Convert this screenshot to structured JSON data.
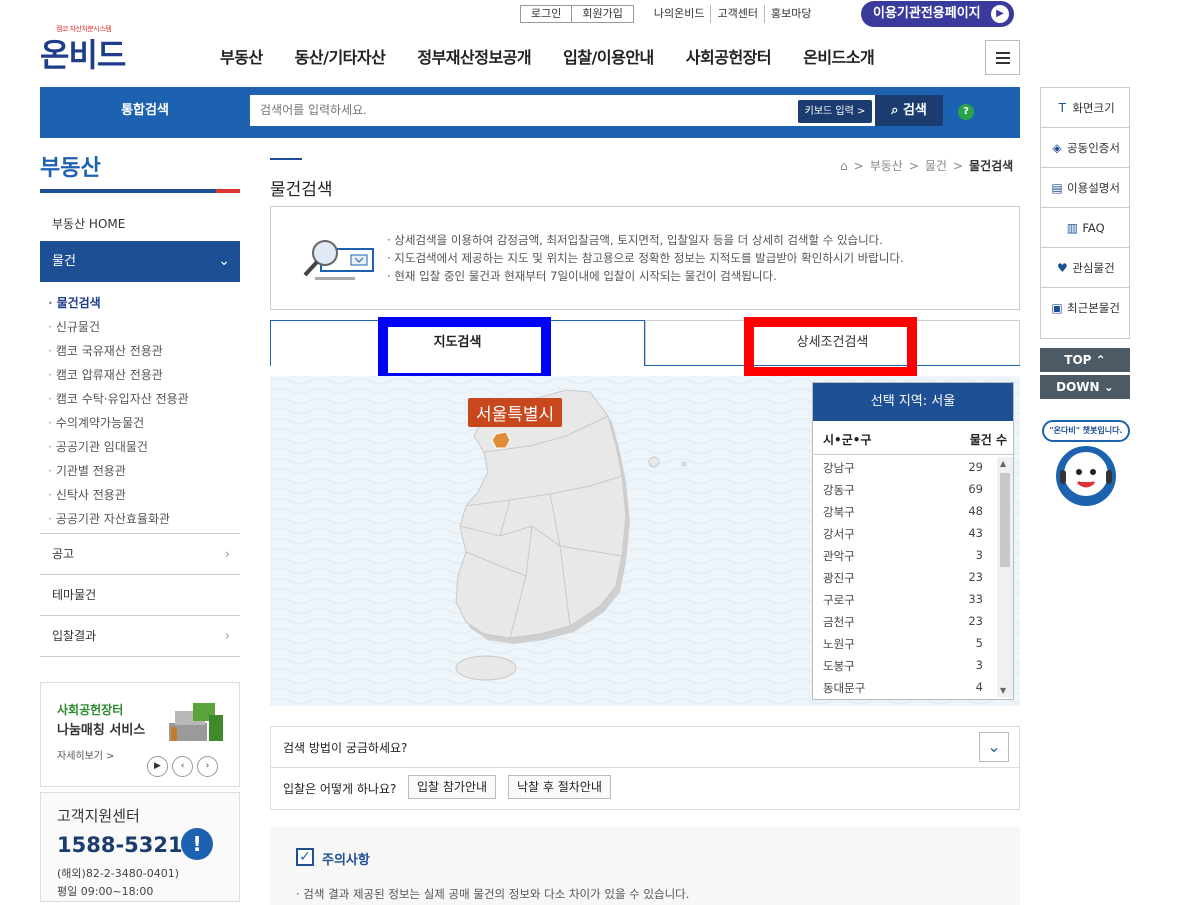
{
  "header": {
    "logo_tagline": "캠코 자산처분시스템",
    "logo_name": "온비드",
    "util_login": "로그인",
    "util_signup": "회원가입",
    "util_links": [
      "나의온비드",
      "고객센터",
      "홍보마당"
    ],
    "agency_button": "이용기관전용페이지",
    "gnb": [
      "부동산",
      "동산/기타자산",
      "정부재산정보공개",
      "입찰/이용안내",
      "사회공헌장터",
      "온비드소개"
    ]
  },
  "search": {
    "label": "통합검색",
    "placeholder": "검색어를 입력하세요.",
    "keyboard_label": "키보드 입력 >",
    "button_label": "검색",
    "help_label": "?"
  },
  "sidebar": {
    "title": "부동산",
    "home": "부동산 HOME",
    "active_section": "물건",
    "sub_items": [
      "물건검색",
      "신규물건",
      "캠코 국유재산 전용관",
      "캠코 압류재산 전용관",
      "캠코 수탁·유입자산 전용관",
      "수의계약가능물건",
      "공공기관 임대물건",
      "기관별 전용관",
      "신탁사 전용관",
      "공공기관 자산효율화관"
    ],
    "sections": [
      "공고",
      "테마물건",
      "입찰결과"
    ]
  },
  "banner_share": {
    "line1": "사회공헌장터",
    "line2": "나눔매칭 서비스",
    "more": "자세히보기 >"
  },
  "banner_support": {
    "title": "고객지원센터",
    "phone": "1588-5321",
    "overseas": "(해외)82-2-3480-0401)",
    "hours": "평일 09:00~18:00"
  },
  "main": {
    "page_title": "물건검색",
    "breadcrumb": [
      "부동산",
      "물건",
      "물건검색"
    ],
    "info_lines": [
      "· 상세검색을 이용하여 감정금액, 최저입찰금액, 토지면적, 입찰일자 등을 더 상세히 검색할 수 있습니다.",
      "· 지도검색에서 제공하는 지도 및 위치는 참고용으로 정확한 정보는 지적도를 발급받아 확인하시기 바랍니다.",
      "· 현재 입찰 중인 물건과 현재부터 7일이내에 입찰이 시작되는 물건이 검색됩니다."
    ],
    "tab_map": "지도검색",
    "tab_detail": "상세조건검색",
    "map_region_label": "서울특별시",
    "panel_header": "선택 지역: 서울",
    "col_district": "시•군•구",
    "col_count": "물건 수",
    "districts": [
      {
        "name": "강남구",
        "count": "29"
      },
      {
        "name": "강동구",
        "count": "69"
      },
      {
        "name": "강북구",
        "count": "48"
      },
      {
        "name": "강서구",
        "count": "43"
      },
      {
        "name": "관악구",
        "count": "3"
      },
      {
        "name": "광진구",
        "count": "23"
      },
      {
        "name": "구로구",
        "count": "33"
      },
      {
        "name": "금천구",
        "count": "23"
      },
      {
        "name": "노원구",
        "count": "5"
      },
      {
        "name": "도봉구",
        "count": "3"
      },
      {
        "name": "동대문구",
        "count": "4"
      }
    ],
    "faq_question": "검색 방법이 궁금하세요?",
    "faq_answer_label": "입찰은 어떻게 하나요?",
    "faq_btn1": "입찰 참가안내",
    "faq_btn2": "낙찰 후 절차안내",
    "notice_title": "주의사항",
    "notice_line": "· 검색 결과 제공된 정보는 실제 공매 물건의 정보와 다소 차이가 있을 수 있습니다."
  },
  "quick": {
    "items": [
      "화면크기",
      "공동인증서",
      "이용설명서",
      "FAQ",
      "관심물건",
      "최근본물건"
    ],
    "top": "TOP",
    "down": "DOWN",
    "chatbot_bubble": "\"온다비\" 챗봇입니다."
  },
  "colors": {
    "primary": "#1d62b0",
    "navy": "#1d4f94",
    "highlight_region": "#c8471d"
  }
}
